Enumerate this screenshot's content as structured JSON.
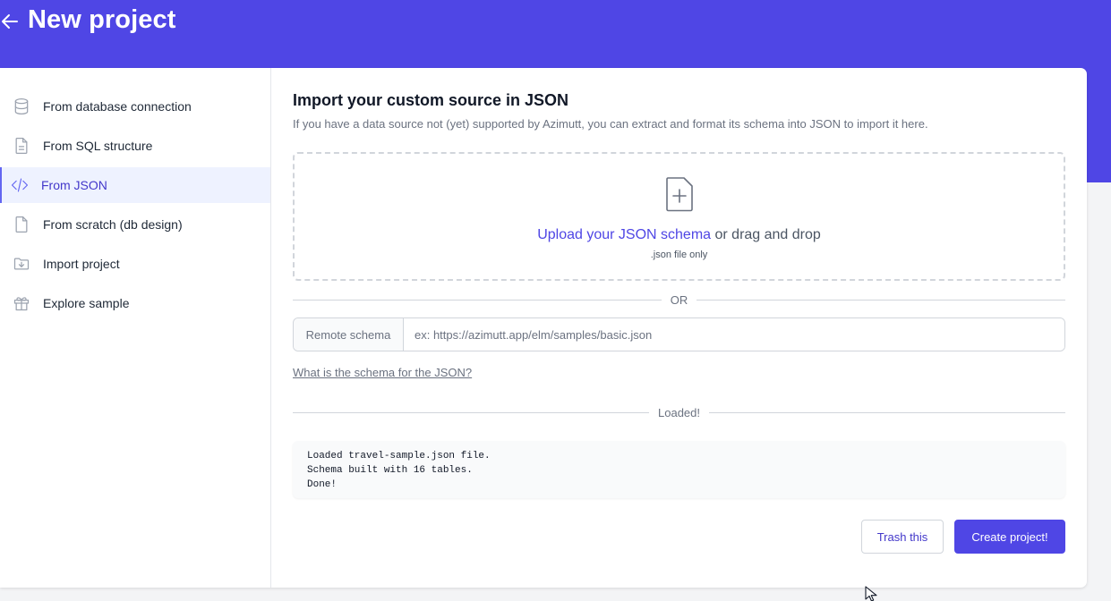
{
  "header": {
    "title": "New project",
    "back_icon": "arrow-left-icon",
    "color": "#4f46e5"
  },
  "sidebar": {
    "items": [
      {
        "label": "From database connection",
        "icon": "database-icon",
        "active": false
      },
      {
        "label": "From SQL structure",
        "icon": "document-text-icon",
        "active": false
      },
      {
        "label": "From JSON",
        "icon": "code-icon",
        "active": true
      },
      {
        "label": "From scratch (db design)",
        "icon": "document-icon",
        "active": false
      },
      {
        "label": "Import project",
        "icon": "folder-download-icon",
        "active": false
      },
      {
        "label": "Explore sample",
        "icon": "gift-icon",
        "active": false
      }
    ]
  },
  "main": {
    "title": "Import your custom source in JSON",
    "description": "If you have a data source not (yet) supported by Azimutt, you can extract and format its schema into JSON to import it here.",
    "dropzone": {
      "icon": "document-add-icon",
      "link_text": "Upload your JSON schema",
      "rest_text": " or drag and drop",
      "hint": ".json file only"
    },
    "or_label": "OR",
    "remote": {
      "label": "Remote schema",
      "placeholder": "ex: https://azimutt.app/elm/samples/basic.json",
      "value": ""
    },
    "schema_link": "What is the schema for the JSON?",
    "loaded_label": "Loaded!",
    "log_lines": [
      "Loaded travel-sample.json file.",
      "Schema built with 16 tables.",
      "Done!"
    ],
    "actions": {
      "trash": "Trash this",
      "create": "Create project!"
    }
  }
}
